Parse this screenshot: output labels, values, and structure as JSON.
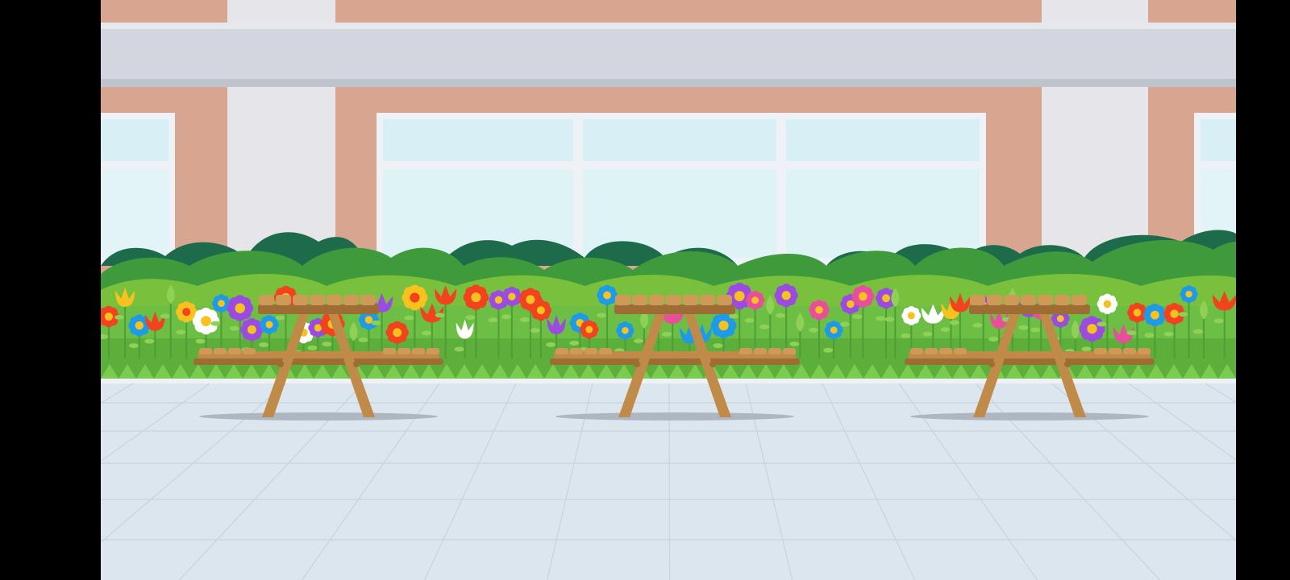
{
  "viewport": {
    "letterbox": "pillarbox"
  },
  "scene": {
    "name": "school-courtyard-background",
    "colors": {
      "brick": "#D8A590",
      "brick_dark": "#C98F7A",
      "pillar": "#E6E5EA",
      "ledge": "#D3D6DE",
      "window_frame": "#EEF2F6",
      "glass": "#D8F0F5",
      "bush_dark": "#1E6B4C",
      "bush_mid": "#3E9A3B",
      "bush_light": "#79C13C",
      "grass": "#6DBE45",
      "floor": "#DCE6EE",
      "floor_line": "#C7D3DE",
      "wood": "#C08A49",
      "wood_dark": "#9E6D34",
      "shadow": "#AEB6C2"
    },
    "flower_colors": [
      "#F2421E",
      "#FFFFFF",
      "#9B4BE0",
      "#1E9BE8",
      "#E94E9A",
      "#F7C21E"
    ],
    "benches": [
      {
        "id": "picnic-table-1"
      },
      {
        "id": "picnic-table-2"
      },
      {
        "id": "picnic-table-3"
      }
    ]
  }
}
